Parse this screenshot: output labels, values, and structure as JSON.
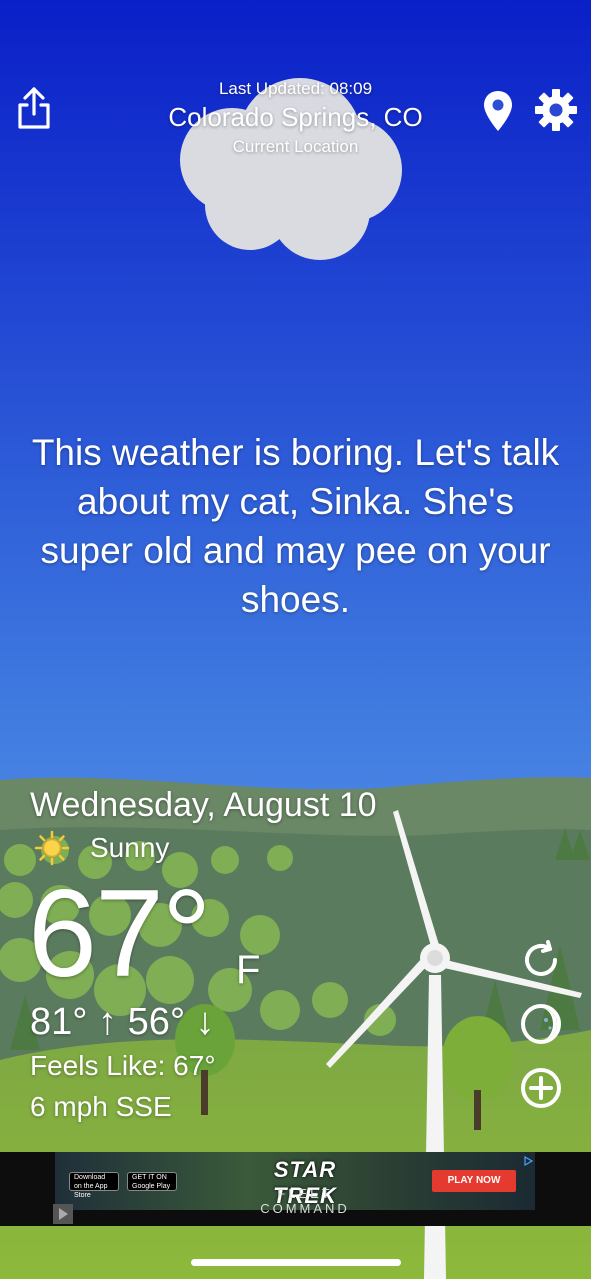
{
  "header": {
    "last_updated": "Last Updated: 08:09",
    "location": "Colorado Springs, CO",
    "location_sub": "Current Location"
  },
  "joke": "This weather is boring. Let's talk about my cat, Sinka. She's super old and may pee on your shoes.",
  "weather": {
    "date": "Wednesday, August 10",
    "condition": "Sunny",
    "condition_icon": "sun-icon",
    "temperature": "67°",
    "unit": "F",
    "high_low": "81° ↑ 56° ↓",
    "feels_like": "Feels Like: 67°",
    "wind": "6 mph SSE"
  },
  "toolbar": {
    "share_icon": "share-icon",
    "location_icon": "location-pin-icon",
    "settings_icon": "gear-icon"
  },
  "side_actions": [
    {
      "icon": "refresh-icon"
    },
    {
      "icon": "moon-phase-icon"
    },
    {
      "icon": "add-icon"
    }
  ],
  "ad": {
    "title": "STAR TREK",
    "subtitle": "FLEET COMMAND",
    "cta": "PLAY NOW",
    "badge_app_store": "Download on the App Store",
    "badge_google_play": "GET IT ON Google Play"
  },
  "colors": {
    "sky_top": "#0a1fc8",
    "sky_bottom": "#6aa8f0",
    "hill_far": "#607c5d",
    "hill_near": "#86ad3c",
    "ad_cta": "#e53a2f"
  }
}
